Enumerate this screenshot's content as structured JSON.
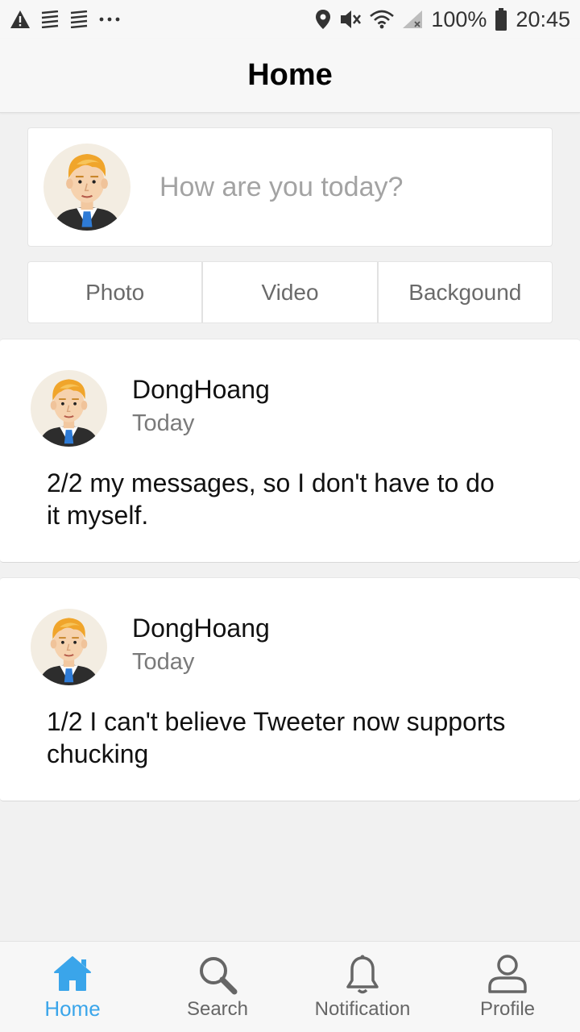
{
  "status_bar": {
    "icons_left": [
      "warning-icon",
      "notes-icon",
      "notes-icon",
      "more-dots-icon"
    ],
    "icons_right": [
      "location-icon",
      "mute-icon",
      "wifi-icon",
      "signal-icon",
      "battery-icon"
    ],
    "battery": "100%",
    "time": "20:45"
  },
  "header": {
    "title": "Home"
  },
  "composer": {
    "placeholder": "How are you today?",
    "buttons": [
      "Photo",
      "Video",
      "Backgound"
    ]
  },
  "posts": [
    {
      "author": "DongHoang",
      "time": "Today",
      "text": "2/2 my messages, so I don't have to do it myself."
    },
    {
      "author": "DongHoang",
      "time": "Today",
      "text": "1/2 I can't believe Tweeter now supports chucking"
    }
  ],
  "bottom_nav": {
    "items": [
      {
        "label": "Home",
        "icon": "home-icon",
        "active": true
      },
      {
        "label": "Search",
        "icon": "search-icon",
        "active": false
      },
      {
        "label": "Notification",
        "icon": "bell-icon",
        "active": false
      },
      {
        "label": "Profile",
        "icon": "person-icon",
        "active": false
      }
    ]
  },
  "colors": {
    "accent": "#3aa5ea",
    "background": "#f1f1f1",
    "card": "#ffffff"
  }
}
